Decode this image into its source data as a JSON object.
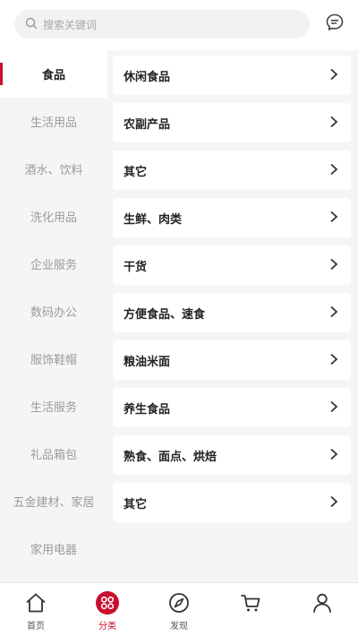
{
  "search": {
    "placeholder": "搜索关键词"
  },
  "sidebar": {
    "items": [
      {
        "label": "食品"
      },
      {
        "label": "生活用品"
      },
      {
        "label": "酒水、饮料"
      },
      {
        "label": "洗化用品"
      },
      {
        "label": "企业服务"
      },
      {
        "label": "数码办公"
      },
      {
        "label": "服饰鞋帽"
      },
      {
        "label": "生活服务"
      },
      {
        "label": "礼品箱包"
      },
      {
        "label": "五金建材、家居"
      },
      {
        "label": "家用电器"
      }
    ],
    "active_index": 0
  },
  "subcategories": [
    {
      "label": "休闲食品"
    },
    {
      "label": "农副产品"
    },
    {
      "label": "其它"
    },
    {
      "label": "生鲜、肉类"
    },
    {
      "label": "干货"
    },
    {
      "label": "方便食品、速食"
    },
    {
      "label": "粮油米面"
    },
    {
      "label": "养生食品"
    },
    {
      "label": "熟食、面点、烘焙"
    },
    {
      "label": "其它"
    }
  ],
  "tabbar": {
    "tabs": [
      {
        "label": "首页",
        "icon": "home-icon"
      },
      {
        "label": "分类",
        "icon": "category-icon"
      },
      {
        "label": "发现",
        "icon": "discover-icon"
      },
      {
        "label": "",
        "icon": "cart-icon"
      },
      {
        "label": "",
        "icon": "user-icon"
      }
    ],
    "active_index": 1
  },
  "colors": {
    "accent": "#c8102e",
    "background": "#f5f5f5"
  }
}
